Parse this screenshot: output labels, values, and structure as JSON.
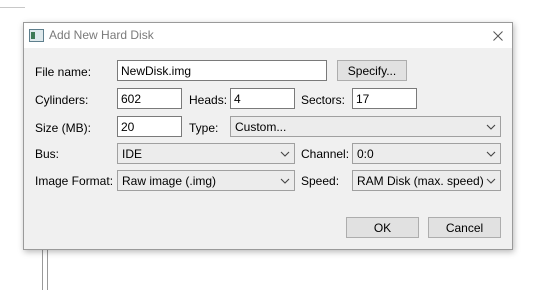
{
  "dialog": {
    "title": "Add New Hard Disk",
    "close_icon": "close-icon",
    "app_icon": "hard-disk-app-icon"
  },
  "form": {
    "file_name_label": "File name:",
    "file_name_value": "NewDisk.img",
    "specify_label": "Specify...",
    "cylinders_label": "Cylinders:",
    "cylinders_value": "602",
    "heads_label": "Heads:",
    "heads_value": "4",
    "sectors_label": "Sectors:",
    "sectors_value": "17",
    "size_label": "Size (MB):",
    "size_value": "20",
    "type_label": "Type:",
    "type_value": "Custom...",
    "bus_label": "Bus:",
    "bus_value": "IDE",
    "channel_label": "Channel:",
    "channel_value": "0:0",
    "image_format_label": "Image Format:",
    "image_format_value": "Raw image (.img)",
    "speed_label": "Speed:",
    "speed_value": "RAM Disk (max. speed)"
  },
  "buttons": {
    "ok_label": "OK",
    "cancel_label": "Cancel"
  }
}
